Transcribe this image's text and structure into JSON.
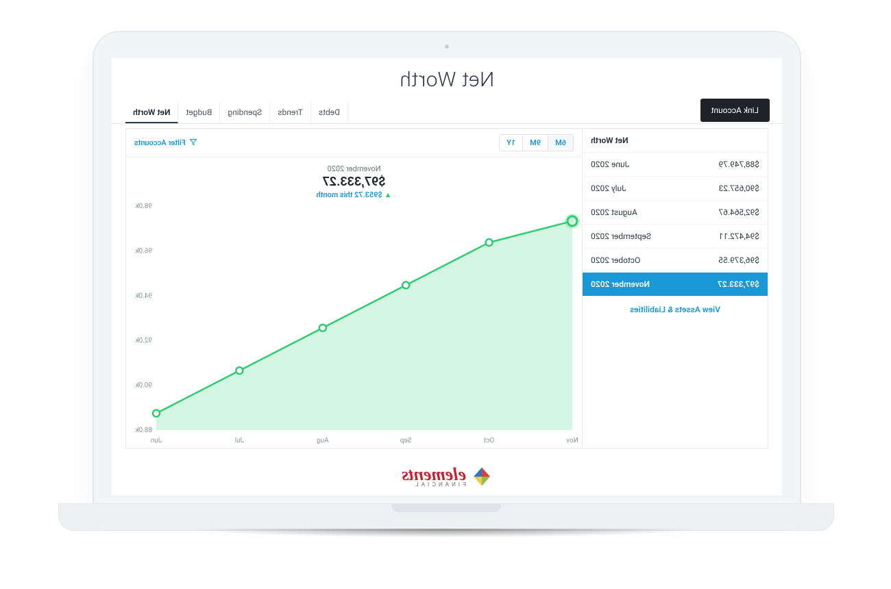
{
  "title": "Net Worth",
  "link_account_label": "Link Account",
  "tabs": [
    "Net Worth",
    "Budget",
    "Spending",
    "Trends",
    "Debts"
  ],
  "active_tab": 0,
  "filter_label": "Filter Accounts",
  "ranges": [
    "6M",
    "9M",
    "1Y"
  ],
  "active_range": 0,
  "summary": {
    "month": "November 2020",
    "amount": "$97,333.27",
    "delta": "$953.72 this month",
    "delta_arrow": "▲"
  },
  "side_header": "Net Worth",
  "rows": [
    {
      "label": "June 2020",
      "value": "$88,749.79"
    },
    {
      "label": "July 2020",
      "value": "$90,657.23"
    },
    {
      "label": "August 2020",
      "value": "$92,564.67"
    },
    {
      "label": "September 2020",
      "value": "$94,472.11"
    },
    {
      "label": "October 2020",
      "value": "$96,379.55"
    },
    {
      "label": "November 2020",
      "value": "$97,333.27"
    }
  ],
  "view_link": "View Assets & Liabilities",
  "logo": {
    "brand": "elements",
    "sub": "FINANCIAL"
  },
  "chart_data": {
    "type": "line",
    "title": "Net Worth",
    "xlabel": "",
    "ylabel": "",
    "ylim": [
      88000,
      98000
    ],
    "y_ticks": [
      "88.0k",
      "90.0k",
      "92.0k",
      "94.0k",
      "96.0k",
      "98.0k"
    ],
    "x_labels": [
      "Jun",
      "Jul",
      "Aug",
      "Sep",
      "Oct",
      "Nov"
    ],
    "x": [
      "Jun",
      "Jul",
      "Aug",
      "Sep",
      "Oct",
      "Nov"
    ],
    "values": [
      88749.79,
      90657.23,
      92564.67,
      94472.11,
      96379.55,
      97333.27
    ],
    "selected_index": 5,
    "colors": {
      "line": "#2ecc71",
      "area": "rgba(46,204,113,0.20)"
    }
  }
}
